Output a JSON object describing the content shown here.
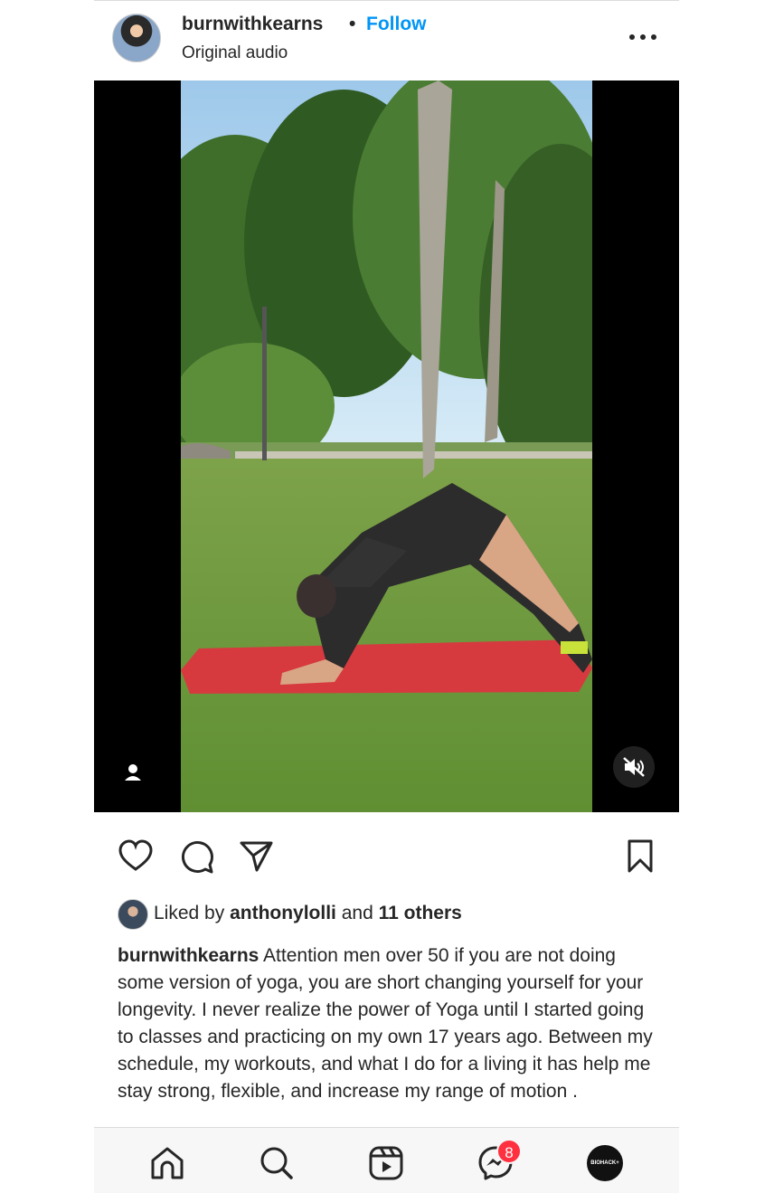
{
  "post": {
    "username": "burnwithkearns",
    "separator": "•",
    "follow_label": "Follow",
    "audio_label": "Original audio",
    "more_icon": "more-options-icon"
  },
  "media": {
    "tag_icon": "user-tag-icon",
    "mute_icon": "volume-muted-icon"
  },
  "actions": {
    "like_icon": "heart-icon",
    "comment_icon": "comment-icon",
    "share_icon": "send-icon",
    "save_icon": "bookmark-icon"
  },
  "likes": {
    "prefix": "Liked by ",
    "user": "anthonylolli",
    "middle": " and ",
    "others": "11 others"
  },
  "caption": {
    "username": "burnwithkearns",
    "text": " Attention men over 50 if you are not doing some version of yoga, you are short changing yourself for your longevity. I never realize the power of Yoga until I started going to classes and practicing on my own 17 years ago. Between my schedule, my workouts, and what I do for a living it has help me stay strong, flexible, and increase my range of motion ."
  },
  "nav": {
    "home_icon": "home-icon",
    "search_icon": "search-icon",
    "reels_icon": "reels-icon",
    "messenger_icon": "messenger-icon",
    "messenger_badge": "8",
    "profile_label": "BIOHACK+"
  },
  "colors": {
    "follow": "#0095f6",
    "badge": "#ff3040"
  }
}
